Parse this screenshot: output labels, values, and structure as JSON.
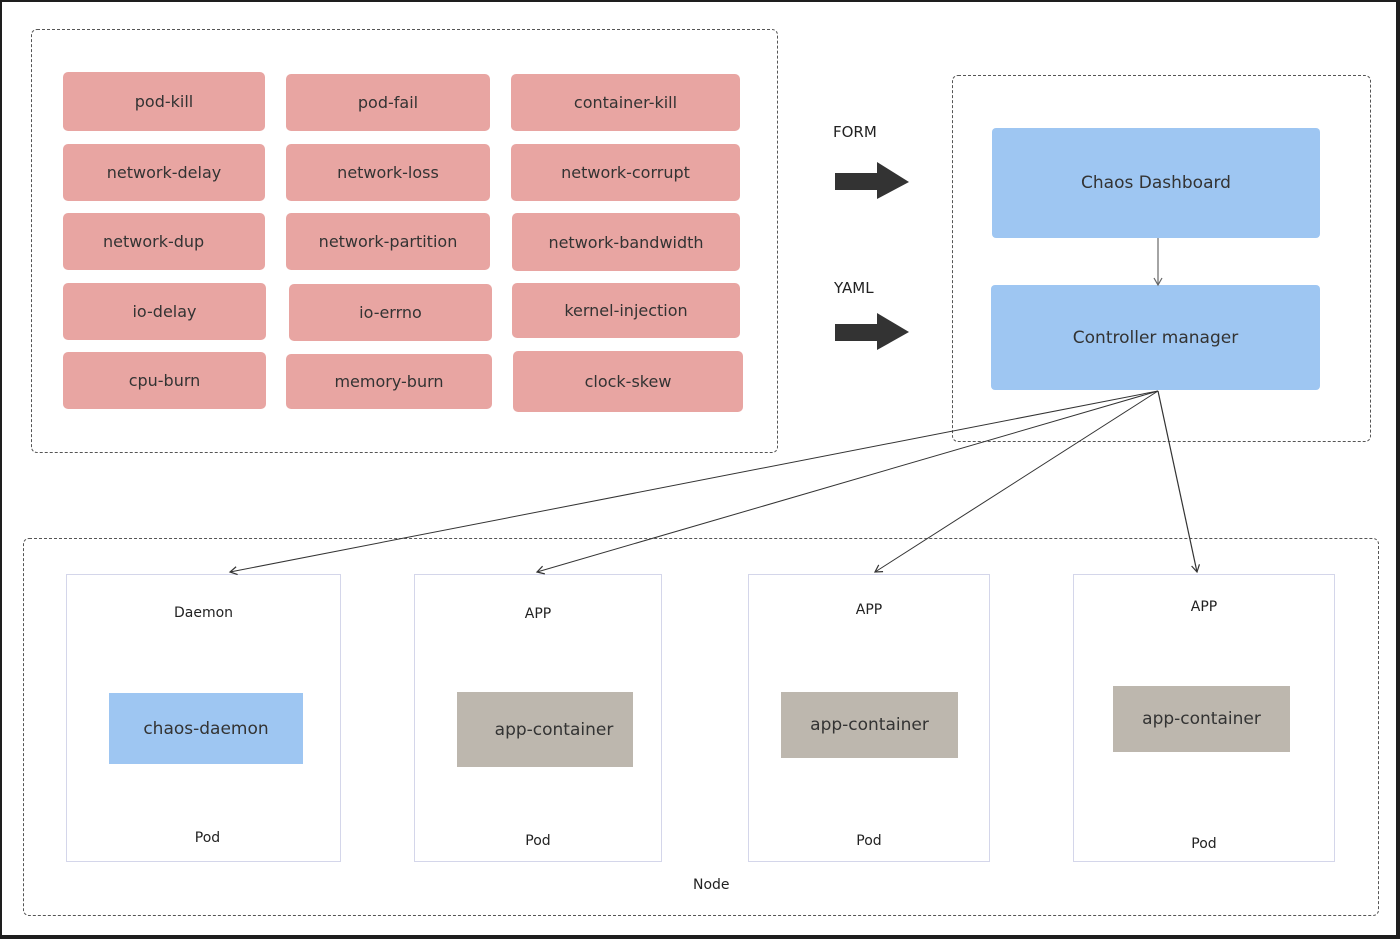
{
  "chaos_types": [
    "pod-kill",
    "pod-fail",
    "container-kill",
    "network-delay",
    "network-loss",
    "network-corrupt",
    "network-dup",
    "network-partition",
    "network-bandwidth",
    "io-delay",
    "io-errno",
    "kernel-injection",
    "cpu-burn",
    "memory-burn",
    "clock-skew"
  ],
  "inputs": {
    "form_label": "FORM",
    "yaml_label": "YAML"
  },
  "control_plane": {
    "dashboard": "Chaos Dashboard",
    "controller": "Controller manager"
  },
  "node": {
    "label": "Node",
    "pods": [
      {
        "title": "Daemon",
        "container": "chaos-daemon",
        "footer": "Pod"
      },
      {
        "title": "APP",
        "container": "app-container",
        "footer": "Pod"
      },
      {
        "title": "APP",
        "container": "app-container",
        "footer": "Pod"
      },
      {
        "title": "APP",
        "container": "app-container",
        "footer": "Pod"
      }
    ]
  },
  "colors": {
    "chaos_chip": "#e8a5a2",
    "control_blue": "#9ec6f2",
    "app_container": "#bdb7ae"
  }
}
